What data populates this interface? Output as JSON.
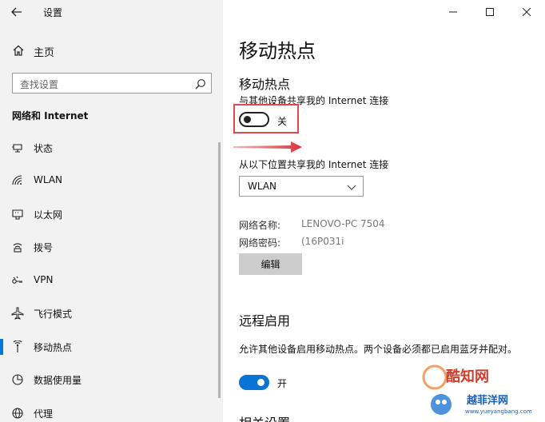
{
  "window": {
    "app_title": "设置",
    "controls": [
      "minimize",
      "maximize",
      "close"
    ]
  },
  "sidebar": {
    "home_label": "主页",
    "search_placeholder": "查找设置",
    "section_heading": "网络和 Internet",
    "items": [
      {
        "label": "状态",
        "icon": "status-icon"
      },
      {
        "label": "WLAN",
        "icon": "wifi-icon"
      },
      {
        "label": "以太网",
        "icon": "ethernet-icon"
      },
      {
        "label": "拨号",
        "icon": "dialup-icon"
      },
      {
        "label": "VPN",
        "icon": "vpn-icon"
      },
      {
        "label": "飞行模式",
        "icon": "airplane-icon"
      },
      {
        "label": "移动热点",
        "icon": "hotspot-icon",
        "active": true
      },
      {
        "label": "数据使用量",
        "icon": "data-usage-icon"
      },
      {
        "label": "代理",
        "icon": "globe-icon"
      }
    ]
  },
  "main": {
    "page_title": "移动热点",
    "hotspot": {
      "title": "移动热点",
      "description": "与其他设备共享我的 Internet 连接",
      "toggle_state": "关"
    },
    "share_from": {
      "label": "从以下位置共享我的 Internet 连接",
      "selected": "WLAN"
    },
    "network_name": {
      "label": "网络名称:",
      "value": "LENOVO-PC 7504"
    },
    "network_password": {
      "label": "网络密码:",
      "value": "(16P031i"
    },
    "edit_button": "编辑",
    "remote": {
      "title": "远程启用",
      "description": "允许其他设备启用移动热点。两个设备必须都已启用蓝牙并配对。",
      "toggle_state": "开"
    },
    "related_settings": "相关设置"
  },
  "watermark": {
    "brand": "酷知网",
    "sub": "越菲洋网",
    "url": "www.yueyangbang.com"
  },
  "colors": {
    "accent": "#0078d7",
    "toggle_on": "#0a74d4",
    "highlight": "#e0484d",
    "sidebar_bg": "#f2f2f2"
  }
}
